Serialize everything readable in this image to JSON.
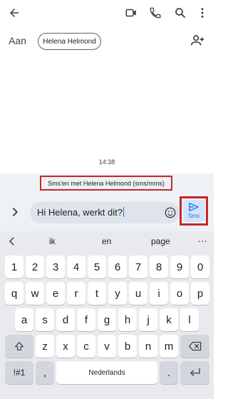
{
  "appbar": {
    "icons": [
      "back-arrow-icon",
      "video-call-icon",
      "phone-icon",
      "search-icon",
      "more-vert-icon"
    ]
  },
  "to": {
    "label": "Aan",
    "chip": "Helena Helmond"
  },
  "conversation": {
    "timestamp": "14:38",
    "info": "Sms'en met Helena Helmond (sms/mms)"
  },
  "compose": {
    "text": "Hi Helena, werkt dit?",
    "send_label": "Sms",
    "accent": "#1a73e8",
    "highlight": "#c62828"
  },
  "keyboard": {
    "suggestions": [
      "ik",
      "en",
      "page"
    ],
    "more": "…",
    "row_numbers": [
      "1",
      "2",
      "3",
      "4",
      "5",
      "6",
      "7",
      "8",
      "9",
      "0"
    ],
    "row1": [
      "q",
      "w",
      "e",
      "r",
      "t",
      "y",
      "u",
      "i",
      "o",
      "p"
    ],
    "row2": [
      "a",
      "s",
      "d",
      "f",
      "g",
      "h",
      "j",
      "k",
      "l"
    ],
    "row3": [
      "z",
      "x",
      "c",
      "v",
      "b",
      "n",
      "m"
    ],
    "symbols": "!#1",
    "comma": ",",
    "space": "Nederlands",
    "period": "."
  }
}
